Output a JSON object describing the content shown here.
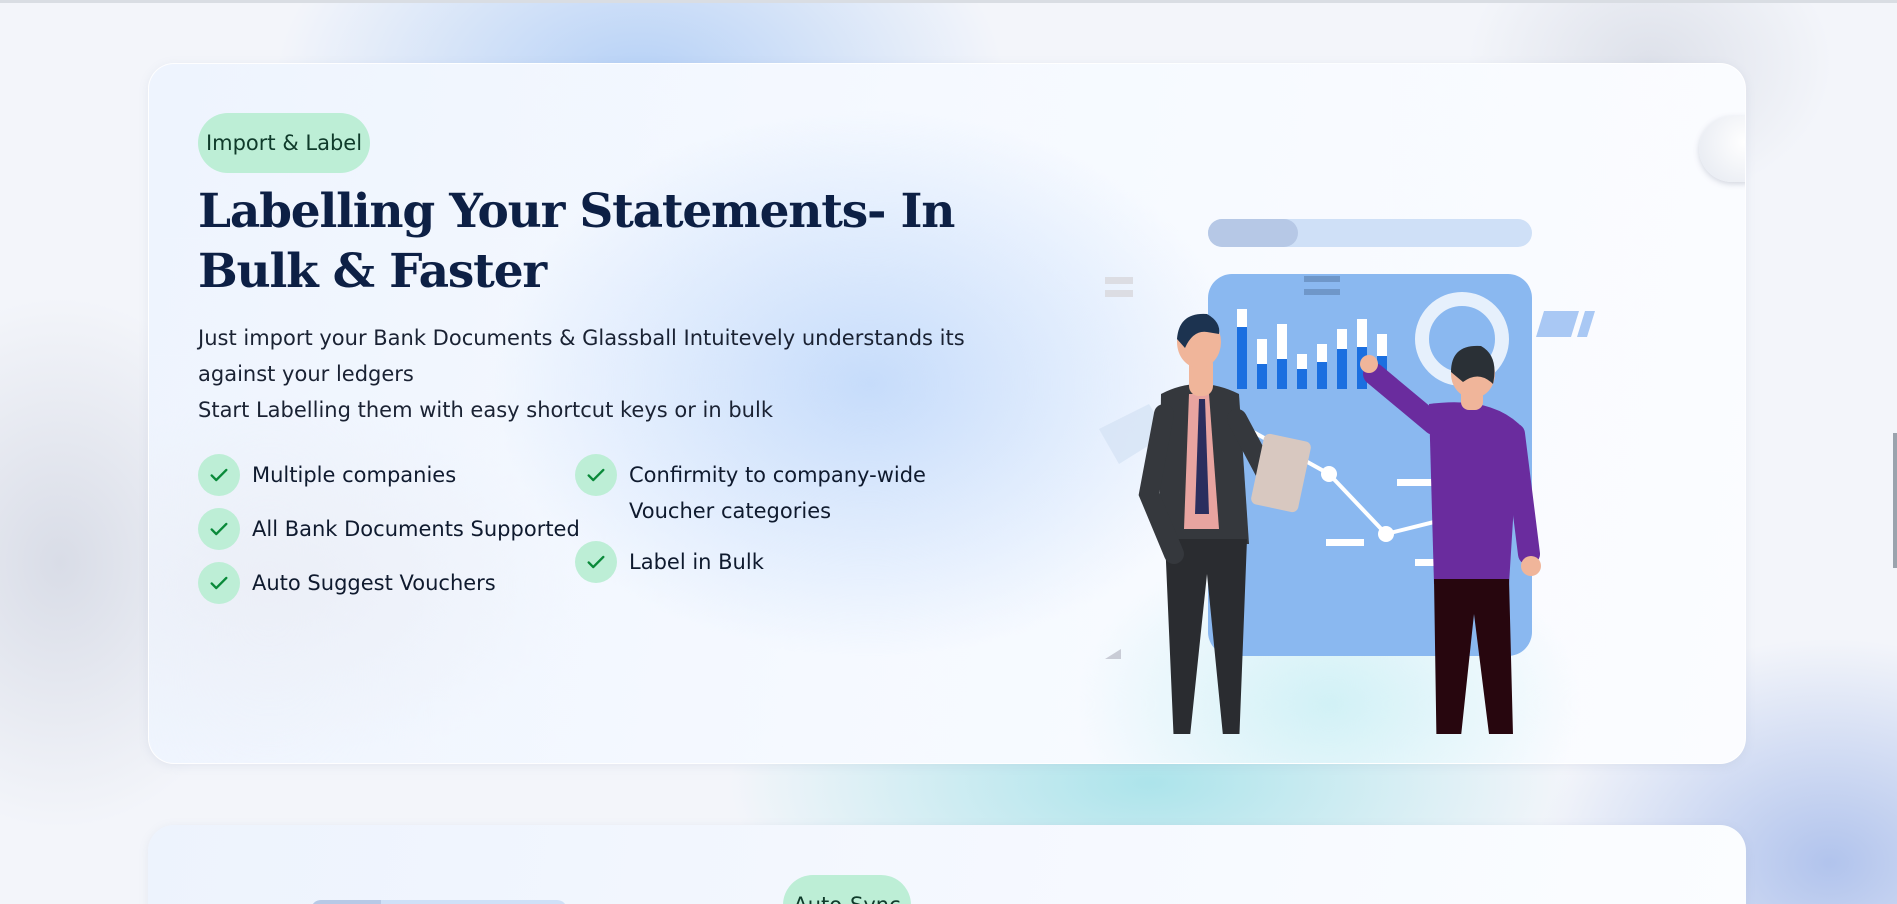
{
  "feature_section": {
    "tag": "Import & Label",
    "heading": "Labelling Your Statements- In Bulk & Faster",
    "description_line1": "Just import your Bank Documents & Glassball Intuitevely understands its against your ledgers",
    "description_line2": "Start Labelling them with easy shortcut keys or in bulk",
    "features_left": [
      "Multiple companies",
      "All Bank Documents Supported",
      "Auto Suggest Vouchers"
    ],
    "features_right": [
      "Confirmity to company-wide Voucher categories",
      "Label in Bulk"
    ]
  },
  "next_section": {
    "tag": "Auto-Sync"
  },
  "colors": {
    "pill_bg": "#bdeed6",
    "check_color": "#0a8a3a",
    "heading_color": "#0d2045",
    "illustration_board": "#8ab8f0",
    "bar_blue": "#1b6fe0",
    "suit_purple": "#6a2c9e"
  },
  "icons": {
    "feature_check": "check-icon"
  }
}
